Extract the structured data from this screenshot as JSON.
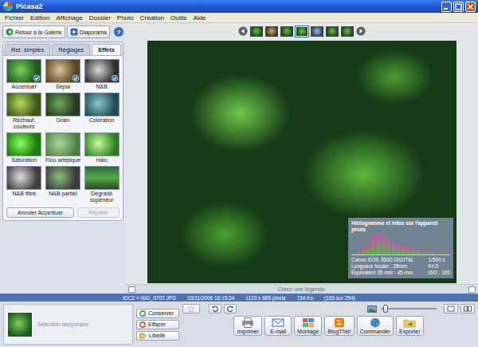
{
  "window": {
    "title": "Picasa2"
  },
  "menu": [
    "Fichier",
    "Edition",
    "Affichage",
    "Dossier",
    "Photo",
    "Création",
    "Outils",
    "Aide"
  ],
  "toolbar": {
    "back": "Retour à la Galerie",
    "slideshow": "Diaporama",
    "help": "?"
  },
  "tabs": [
    {
      "label": "Ret. simples",
      "selected": false
    },
    {
      "label": "Réglages",
      "selected": false
    },
    {
      "label": "Effets",
      "selected": true
    }
  ],
  "effects": [
    {
      "label": "Accentuer",
      "applied": true
    },
    {
      "label": "Sépia",
      "applied": true
    },
    {
      "label": "N&B",
      "applied": true
    },
    {
      "label": "Réchauf. couleurs",
      "applied": false
    },
    {
      "label": "Grain",
      "applied": false
    },
    {
      "label": "Coloration",
      "applied": false
    },
    {
      "label": "Saturation",
      "applied": false
    },
    {
      "label": "Flou artistique",
      "applied": false
    },
    {
      "label": "Halo",
      "applied": false
    },
    {
      "label": "N&B filtré",
      "applied": false
    },
    {
      "label": "N&B partiel",
      "applied": false
    },
    {
      "label": "Dégradé supérieur",
      "applied": false
    }
  ],
  "effect_actions": [
    {
      "label": "Annuler Accentuer",
      "disabled": false
    },
    {
      "label": "Répéter",
      "disabled": true
    }
  ],
  "filmstrip": [
    {
      "selected": false
    },
    {
      "selected": false
    },
    {
      "selected": false
    },
    {
      "selected": true
    },
    {
      "selected": false
    },
    {
      "selected": false
    },
    {
      "selected": false
    }
  ],
  "histogram": {
    "title": "Histogramme et infos sur l'appareil photo",
    "values": [
      4,
      10,
      22,
      40,
      62,
      78,
      70,
      55,
      44,
      36,
      30,
      26,
      22,
      18,
      15,
      12,
      9,
      7,
      5,
      3
    ],
    "info": [
      "Canon EOS 350D DIGITAL",
      "1/500 s",
      "Longueur focale : 28mm",
      "f/4.5",
      "Équivalent 35 mm : 45 mm",
      "ISO : 100"
    ]
  },
  "caption": {
    "placeholder": "Créez une légende."
  },
  "status_bar": [
    "IDC2 » IMG_0707.JPG",
    "03/11/2006 18:15:34",
    "1120 x 885 pixels",
    "734 Ko",
    "(155 sur 254)"
  ],
  "tray": {
    "label": "Sélection temporaire",
    "buttons": [
      {
        "label": "Conserver",
        "kind": "dot",
        "color": "#2e9a3a"
      },
      {
        "label": "Effacer",
        "kind": "dot",
        "color": "#d23a2a"
      },
      {
        "label": "Libellé",
        "kind": "tag"
      }
    ]
  },
  "zoom": {
    "level": 0.08
  },
  "actions": [
    "Imprimer",
    "E-mail",
    "Montage",
    "BlogThis!",
    "Commander",
    "Exporter"
  ]
}
